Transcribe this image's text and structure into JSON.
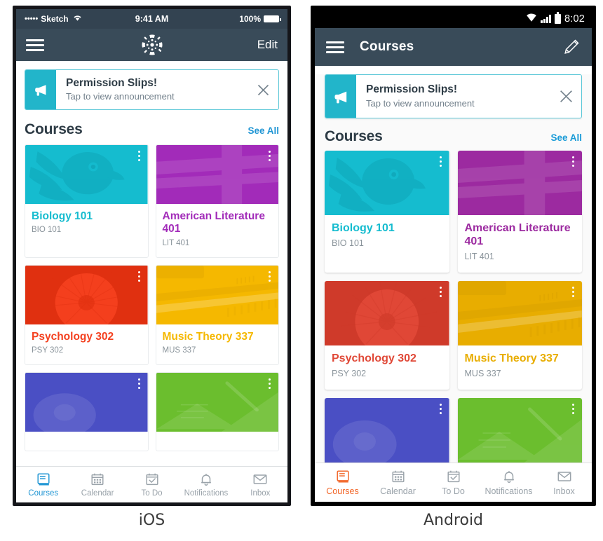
{
  "ios": {
    "platform_caption": "iOS",
    "status_bar": {
      "signal_dots": "•••••",
      "carrier": "Sketch",
      "wifi_icon": "wifi-icon",
      "time": "9:41 AM",
      "battery_percent": "100%",
      "battery_icon": "battery-full-icon"
    },
    "nav_bar": {
      "menu_icon": "hamburger-menu-icon",
      "logo_icon": "canvas-logo-icon",
      "edit_label": "Edit"
    },
    "announcement": {
      "icon": "megaphone-icon",
      "title": "Permission Slips!",
      "subtitle": "Tap to view announcement",
      "close_icon": "close-icon",
      "accent_color": "#22B5CA"
    },
    "section": {
      "title": "Courses",
      "see_all": "See All",
      "link_color": "#2196d4"
    },
    "courses": [
      {
        "name": "Biology 101",
        "code": "BIO 101",
        "color": "#15bccf",
        "color_dark": "#0fa6b8",
        "image": "parrot-photo"
      },
      {
        "name": "American Literature 401",
        "code": "LIT 401",
        "color": "#a22bb9",
        "color_dark": "#8f23a3",
        "image": "books-photo"
      },
      {
        "name": "Psychology 302",
        "code": "PSY 302",
        "color": "#f4401f",
        "color_dark": "#e03010",
        "image": "flower-photo"
      },
      {
        "name": "Music Theory 337",
        "code": "MUS 337",
        "color": "#f5b800",
        "color_dark": "#e2a800",
        "image": "piano-photo"
      },
      {
        "name": "",
        "code": "",
        "color": "#4a4fc4",
        "color_dark": "#3a3fb0",
        "image": "blue-flower-photo"
      },
      {
        "name": "",
        "code": "",
        "color": "#6bbe2e",
        "color_dark": "#5aa826",
        "image": "pen-paper-photo"
      }
    ],
    "tabs": [
      {
        "label": "Courses",
        "icon": "book-icon",
        "active": true
      },
      {
        "label": "Calendar",
        "icon": "calendar-icon",
        "active": false
      },
      {
        "label": "To Do",
        "icon": "checklist-icon",
        "active": false
      },
      {
        "label": "Notifications",
        "icon": "bell-icon",
        "active": false
      },
      {
        "label": "Inbox",
        "icon": "envelope-icon",
        "active": false
      }
    ],
    "active_tab_color": "#2196d4"
  },
  "android": {
    "platform_caption": "Android",
    "status_bar": {
      "wifi_icon": "wifi-icon",
      "signal_icon": "signal-bars-icon",
      "battery_icon": "battery-full-icon",
      "time": "8:02"
    },
    "app_bar": {
      "menu_icon": "hamburger-menu-icon",
      "title": "Courses",
      "edit_icon": "pencil-icon"
    },
    "announcement": {
      "icon": "megaphone-icon",
      "title": "Permission Slips!",
      "subtitle": "Tap to view announcement",
      "close_icon": "close-icon",
      "accent_color": "#22B5CA"
    },
    "section": {
      "title": "Courses",
      "see_all": "See All",
      "link_color": "#1a9bd7"
    },
    "courses": [
      {
        "name": "Biology 101",
        "code": "BIO 101",
        "color": "#15bccf",
        "color_dark": "#0fa6b8",
        "image": "parrot-photo"
      },
      {
        "name": "American Literature 401",
        "code": "LIT 401",
        "color": "#9c2aa0",
        "color_dark": "#8a2390",
        "image": "books-photo"
      },
      {
        "name": "Psychology 302",
        "code": "PSY 302",
        "color": "#e04837",
        "color_dark": "#cf3a2a",
        "image": "flower-photo"
      },
      {
        "name": "Music Theory 337",
        "code": "MUS 337",
        "color": "#e8ad00",
        "color_dark": "#d79f00",
        "image": "piano-photo"
      },
      {
        "name": "",
        "code": "",
        "color": "#4a4fc4",
        "color_dark": "#3a3fb0",
        "image": "blue-flower-photo"
      },
      {
        "name": "",
        "code": "",
        "color": "#6bbe2e",
        "color_dark": "#5aa826",
        "image": "pen-paper-photo"
      }
    ],
    "tabs": [
      {
        "label": "Courses",
        "icon": "book-icon",
        "active": true
      },
      {
        "label": "Calendar",
        "icon": "calendar-icon",
        "active": false
      },
      {
        "label": "To Do",
        "icon": "checklist-icon",
        "active": false
      },
      {
        "label": "Notifications",
        "icon": "bell-icon",
        "active": false
      },
      {
        "label": "Inbox",
        "icon": "envelope-icon",
        "active": false
      }
    ],
    "active_tab_color": "#F26527"
  }
}
